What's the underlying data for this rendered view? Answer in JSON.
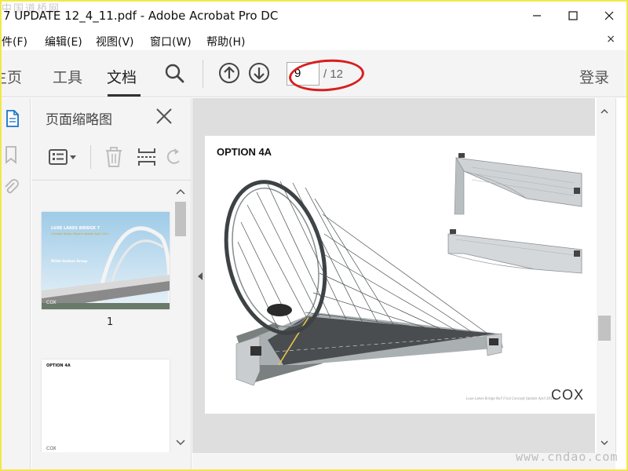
{
  "window": {
    "title": "7 UPDATE 12_4_11.pdf - Adobe Acrobat Pro DC",
    "watermark_top": "中国道桥网",
    "watermark_bottom": "www.cndao.com"
  },
  "menu": {
    "items": [
      "文件(F)",
      "编辑(E)",
      "视图(V)",
      "窗口(W)",
      "帮助(H)"
    ],
    "close_glyph": "×"
  },
  "toolbar": {
    "tabs": [
      "主页",
      "工具",
      "文档"
    ],
    "active_tab": "文档",
    "page_current": "9",
    "page_total": "/ 12",
    "login": "登录"
  },
  "thumbnail_panel": {
    "title": "页面缩略图",
    "pages": [
      {
        "number": "1",
        "headline": "LUXE LAKES BRIDGE 7",
        "subtitle": "Concept Design Report Update April 2011",
        "company": "Wilde Hodson Group",
        "logo": "COX"
      },
      {
        "headline": "OPTION 4A",
        "logo": "COX"
      }
    ]
  },
  "document": {
    "page_heading": "OPTION 4A",
    "caption": "Luxe Lakes Bridge No7 Final Concept Update  April 2011",
    "logo": "COX"
  },
  "colors": {
    "accent_red": "#d81e1e",
    "frame_yellow": "#f2e84a"
  }
}
